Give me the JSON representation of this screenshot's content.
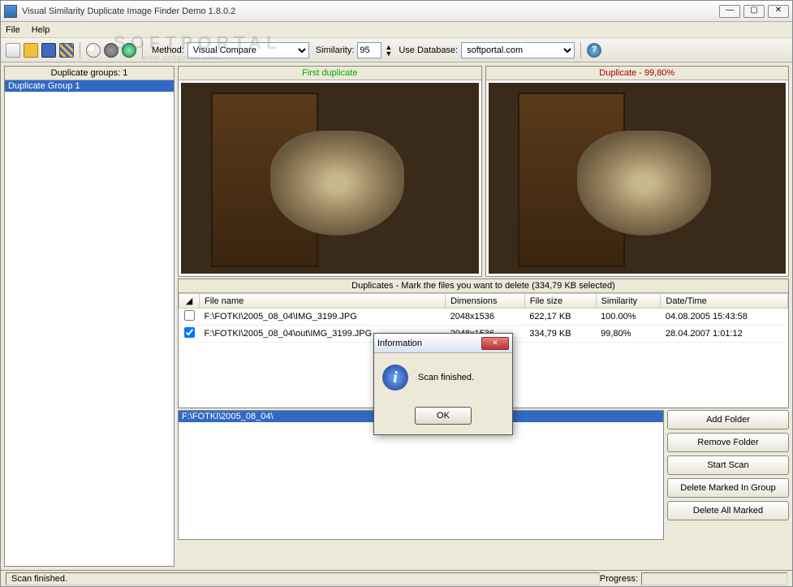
{
  "window": {
    "title": "Visual Similarity Duplicate Image Finder Demo 1.8.0.2"
  },
  "menu": {
    "file": "File",
    "help": "Help"
  },
  "toolbar": {
    "method_label": "Method:",
    "method_value": "Visual Compare",
    "similarity_label": "Similarity:",
    "similarity_value": "95",
    "usedb_label": "Use Database:",
    "usedb_value": "softportal.com"
  },
  "left": {
    "header": "Duplicate groups: 1",
    "items": [
      "Duplicate Group 1"
    ]
  },
  "preview": {
    "first_label": "First duplicate",
    "dup_label": "Duplicate - 99,80%"
  },
  "dup_section": {
    "header": "Duplicates - Mark the files you want to delete (334,79 KB selected)",
    "cols": {
      "file": "File name",
      "dim": "Dimensions",
      "size": "File size",
      "sim": "Similarity",
      "date": "Date/Time"
    },
    "rows": [
      {
        "checked": false,
        "file": "F:\\FOTKI\\2005_08_04\\IMG_3199.JPG",
        "dim": "2048x1536",
        "size": "622,17 KB",
        "sim": "100.00%",
        "date": "04.08.2005 15:43:58"
      },
      {
        "checked": true,
        "file": "F:\\FOTKI\\2005_08_04\\out\\IMG_3199.JPG",
        "dim": "2048x1536",
        "size": "334,79 KB",
        "sim": "99,80%",
        "date": "28.04.2007 1:01:12"
      }
    ]
  },
  "folders": {
    "items": [
      "F:\\FOTKI\\2005_08_04\\"
    ]
  },
  "buttons": {
    "add": "Add Folder",
    "remove": "Remove Folder",
    "start": "Start Scan",
    "del_group": "Delete Marked In Group",
    "del_all": "Delete All Marked"
  },
  "status": {
    "text": "Scan finished.",
    "progress_label": "Progress:"
  },
  "dialog": {
    "title": "Information",
    "message": "Scan finished.",
    "ok": "OK"
  },
  "watermark": {
    "main": "SOFTPORTAL",
    "sub": "www.softportal.com"
  }
}
